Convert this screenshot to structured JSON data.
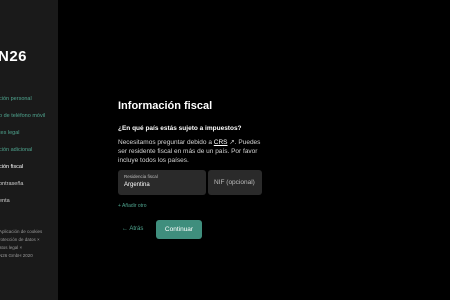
{
  "sidebar": {
    "logo": "N26",
    "steps": [
      {
        "label": "ción personal",
        "state": "done"
      },
      {
        "label": "o de teléfono móvil",
        "state": "done"
      },
      {
        "label": "tes legal",
        "state": "done"
      },
      {
        "label": "ción adicional",
        "state": "done"
      },
      {
        "label": "ción fiscal",
        "state": "active"
      },
      {
        "label": "ontraseña",
        "state": "todo"
      },
      {
        "label": "enta",
        "state": "todo"
      }
    ],
    "footer": [
      "Aplicación de cookies",
      "rotección de datos ×",
      "atos legal ×",
      "N26 GmbH 2020"
    ]
  },
  "main": {
    "title": "Información fiscal",
    "question": "¿En qué país estás sujeto a impuestos?",
    "description_before": "Necesitamos preguntar debido a ",
    "crs_link": "CRS",
    "link_arrow": " ↗",
    "description_after": ". Puedes ser residente fiscal en más de un país. Por favor incluye todos los países.",
    "country_field": {
      "label": "Residencia fiscal",
      "value": "Argentina"
    },
    "nif_field": {
      "placeholder": "NIF (opcional)"
    },
    "add_another": "+ Añadir otro",
    "back": "←  Atrás",
    "continue": "Continuar"
  },
  "colors": {
    "accent": "#4fa58f",
    "button": "#3f8e7d",
    "sidebar_bg": "#1a1a1a",
    "field_bg": "#2a2a2a",
    "background": "#000000"
  }
}
